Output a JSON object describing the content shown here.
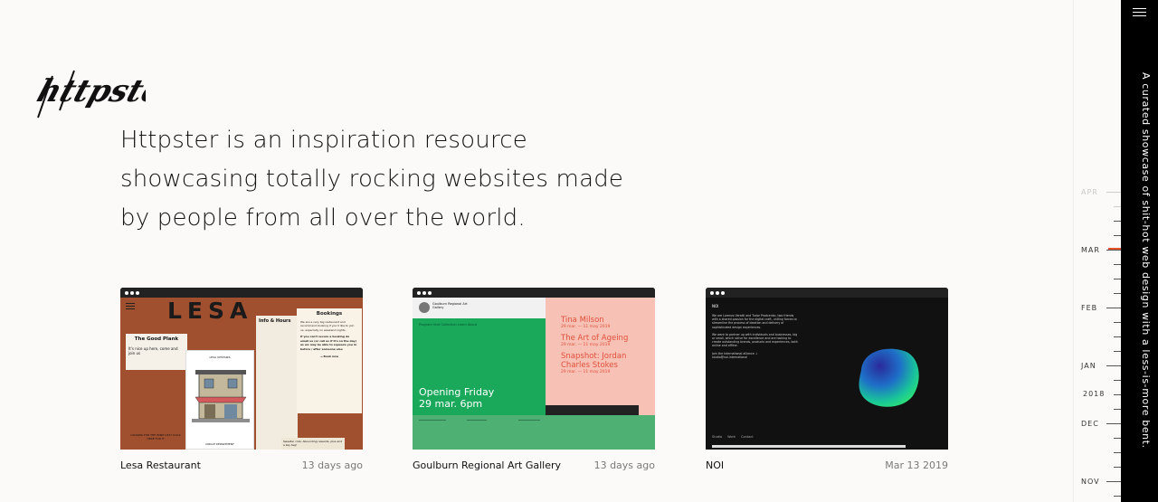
{
  "brand": {
    "logo_text": "httpster"
  },
  "intro": {
    "line1": "Httpster is an inspiration resource",
    "line2": "showcasing totally rocking websites made",
    "line3": "by people from all over the world."
  },
  "cards": [
    {
      "name": "Lesa Restaurant",
      "date": "13 days ago",
      "shot": {
        "title": "LESA",
        "plank_title": "The Good Plank",
        "plank_text": "It's nice up here, come and join us",
        "info_title": "Info & Hours",
        "bookings_title": "Bookings",
        "bookings_text": "We are a very big restaurant and recommend booking if you'd like to join us, especially on weekend nights.",
        "bookings_emph": "If you can't secure a booking do email us (or call us if it's on the day) as we may be able to squeeze you in before / after someone else",
        "book_link": "→ Book now",
        "sketch_label": "LESA UPSTAIRS",
        "sketch_caption": "CIRCLE DEPARTMENT",
        "footer_text": "LOOKING FOR THE WINE LIST? CLICK HERE FOR IT",
        "newsletter": "Sweater club, Abounding rewards, plus and a key tag!"
      }
    },
    {
      "name": "Goulburn Regional Art Gallery",
      "date": "13 days ago",
      "shot": {
        "org_name": "Goulburn Regional Art Gallery",
        "nav_text": "Program  Visit  Collection  Learn  About",
        "headline_line1": "Opening Friday",
        "headline_line2": "29 mar. 6pm",
        "exhibitions": [
          {
            "title": "Tina Milson",
            "dates": "29 mar. — 11 may 2019"
          },
          {
            "title": "The Art of Ageing",
            "dates": "29 mar. — 11 may 2019"
          },
          {
            "title": "Snapshot: Jordan Charles Stokes",
            "dates": "29 mar. — 11 may 2019"
          }
        ]
      }
    },
    {
      "name": "NOI",
      "date": "Mar 13 2019",
      "shot": {
        "brand": "NOI",
        "para1": "We are Lorenzo Veratti and Tudor Prodcenko, two friends with a shared passion for the digital craft, uniting forces to streamline the process of ideation and delivery of sophisticated design experiences.",
        "para2": "We want to partner up with individuals and businesses, big or small, which strive for excellence and are looking to create outstanding brands, products and experiences, both online and offline.",
        "para3": "Join the International alliance ↓",
        "email": "studio@noi.international",
        "nav": [
          "Studio",
          "Work",
          "Contact"
        ]
      }
    }
  ],
  "timeline": {
    "labels": [
      {
        "text": "APR",
        "faint": true
      },
      {
        "text": "MAR",
        "faint": false
      },
      {
        "text": "FEB",
        "faint": false
      },
      {
        "text": "JAN",
        "faint": false
      },
      {
        "text": "2018",
        "faint": false
      },
      {
        "text": "DEC",
        "faint": false
      },
      {
        "text": "NOV",
        "faint": false
      }
    ]
  },
  "rail": {
    "tagline": "A curated showcase of shit-hot web design with a less-is-more bent."
  },
  "colors": {
    "accent": "#e8542a",
    "lesa_bg": "#a0502f",
    "goulburn_green": "#1aa95b",
    "goulburn_pink": "#f7c1b6",
    "noi_bg": "#111111"
  },
  "icons": {
    "menu": "hamburger-menu-icon"
  }
}
